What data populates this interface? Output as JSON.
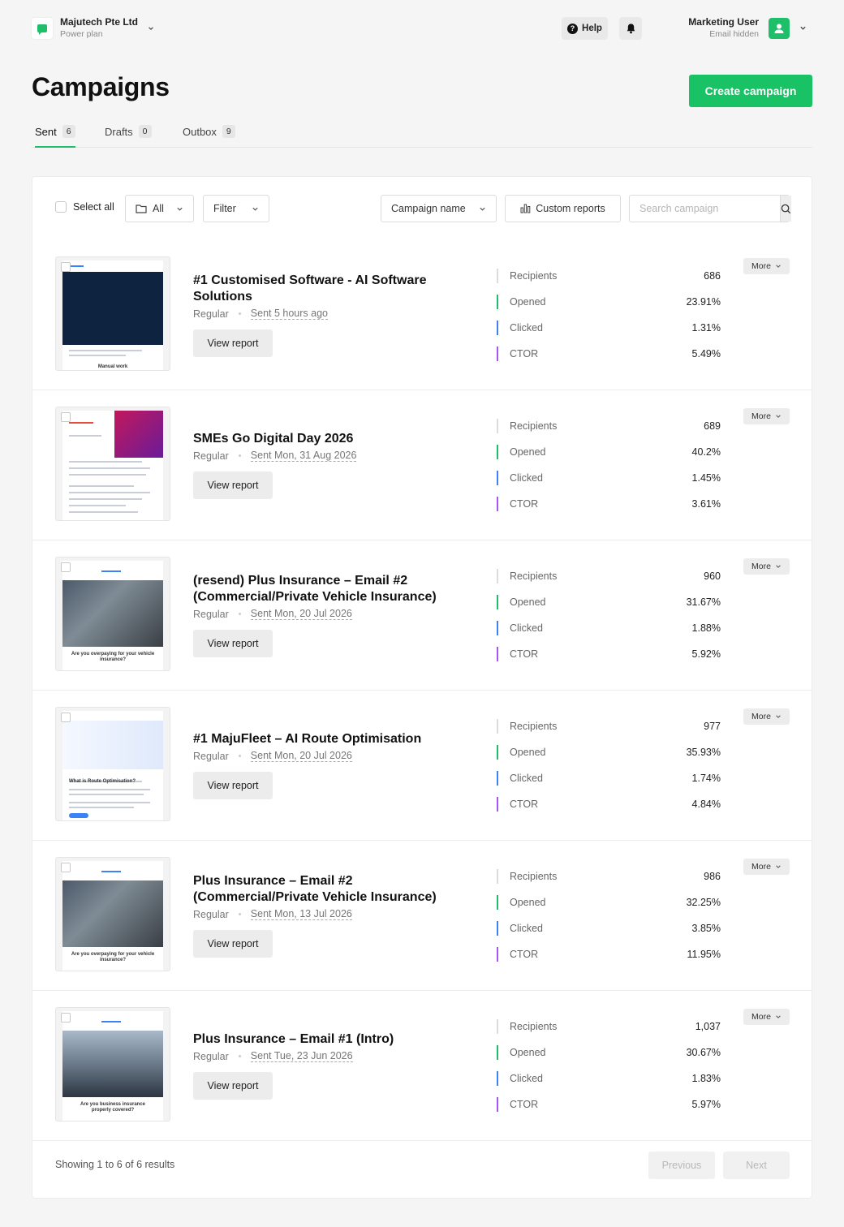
{
  "org": {
    "name": "Majutech Pte Ltd",
    "plan": "Power plan"
  },
  "topbar": {
    "help_label": "Help"
  },
  "user": {
    "name": "Marketing User",
    "email": "Email hidden"
  },
  "header": {
    "title": "Campaigns",
    "create_label": "Create campaign"
  },
  "tabs": [
    {
      "label": "Sent",
      "count": "6",
      "active": true
    },
    {
      "label": "Drafts",
      "count": "0",
      "active": false
    },
    {
      "label": "Outbox",
      "count": "9",
      "active": false
    }
  ],
  "toolbar": {
    "select_all": "Select all",
    "folder_label": "All",
    "filter_label": "Filter",
    "sort_label": "Campaign name",
    "reports_label": "Custom reports",
    "search_placeholder": "Search campaign"
  },
  "stat_labels": {
    "recipients": "Recipients",
    "opened": "Opened",
    "clicked": "Clicked",
    "ctor": "CTOR"
  },
  "row_labels": {
    "view_report": "View report",
    "more": "More"
  },
  "campaigns": [
    {
      "title": "#1 Customised Software - AI Software Solutions",
      "type": "Regular",
      "sent": "Sent 5 hours ago",
      "recipients": "686",
      "opened": "23.91%",
      "clicked": "1.31%",
      "ctor": "5.49%"
    },
    {
      "title": "SMEs Go Digital Day 2026",
      "type": "Regular",
      "sent": "Sent Mon, 31 Aug 2026",
      "recipients": "689",
      "opened": "40.2%",
      "clicked": "1.45%",
      "ctor": "3.61%"
    },
    {
      "title": "(resend) Plus Insurance – Email #2 (Commercial/Private Vehicle Insurance)",
      "type": "Regular",
      "sent": "Sent Mon, 20 Jul 2026",
      "recipients": "960",
      "opened": "31.67%",
      "clicked": "1.88%",
      "ctor": "5.92%"
    },
    {
      "title": "#1 MajuFleet – AI Route Optimisation",
      "type": "Regular",
      "sent": "Sent Mon, 20 Jul 2026",
      "recipients": "977",
      "opened": "35.93%",
      "clicked": "1.74%",
      "ctor": "4.84%"
    },
    {
      "title": "Plus Insurance – Email #2 (Commercial/Private Vehicle Insurance)",
      "type": "Regular",
      "sent": "Sent Mon, 13 Jul 2026",
      "recipients": "986",
      "opened": "32.25%",
      "clicked": "3.85%",
      "ctor": "11.95%"
    },
    {
      "title": "Plus Insurance – Email #1 (Intro)",
      "type": "Regular",
      "sent": "Sent Tue, 23 Jun 2026",
      "recipients": "1,037",
      "opened": "30.67%",
      "clicked": "1.83%",
      "ctor": "5.97%"
    }
  ],
  "thumbnails": [
    {
      "caption": "Manual work"
    },
    {
      "caption": ""
    },
    {
      "caption": "Are you overpaying for your vehicle insurance?"
    },
    {
      "caption": "What is Route Optimisation?"
    },
    {
      "caption": "Are you overpaying for your vehicle insurance?"
    },
    {
      "caption": "Are you business insurance properly covered?"
    }
  ],
  "pagination": {
    "summary": "Showing 1 to 6 of 6 results",
    "previous": "Previous",
    "next": "Next"
  },
  "colors": {
    "brand": "#1fbf6a",
    "opened": "#1fbf6a",
    "clicked": "#3b82f6",
    "ctor": "#a855f7"
  }
}
